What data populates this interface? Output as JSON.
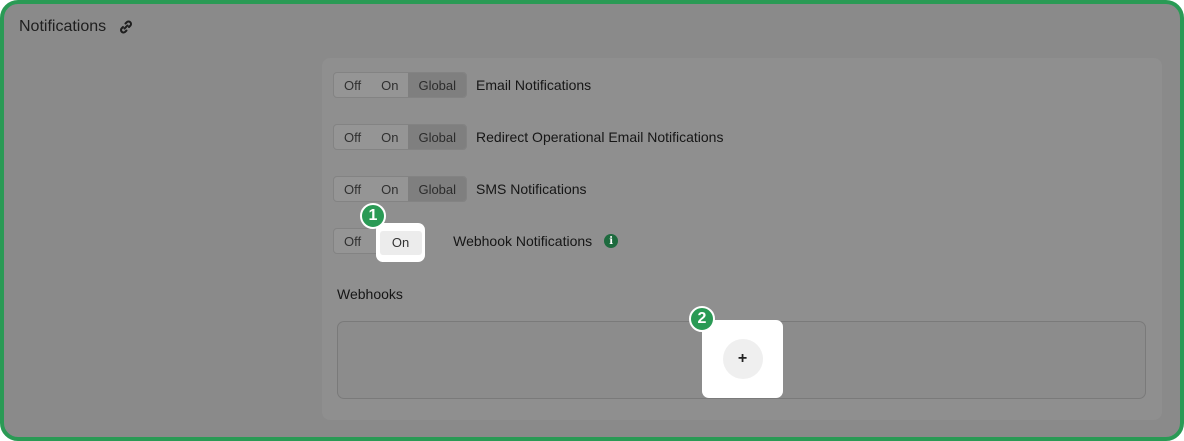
{
  "header": {
    "title": "Notifications",
    "link_icon": "link-icon"
  },
  "toggle": {
    "off": "Off",
    "on": "On",
    "global": "Global"
  },
  "rows": [
    {
      "label": "Email Notifications"
    },
    {
      "label": "Redirect Operational Email Notifications"
    },
    {
      "label": "SMS Notifications"
    },
    {
      "label": "Webhook Notifications",
      "info_icon": "info-icon",
      "info_glyph": "i"
    }
  ],
  "webhooks": {
    "title": "Webhooks",
    "add_label": "+"
  },
  "markers": {
    "first": "1",
    "second": "2"
  },
  "colors": {
    "accent": "#2a9a55",
    "info": "#1d6a3e"
  }
}
